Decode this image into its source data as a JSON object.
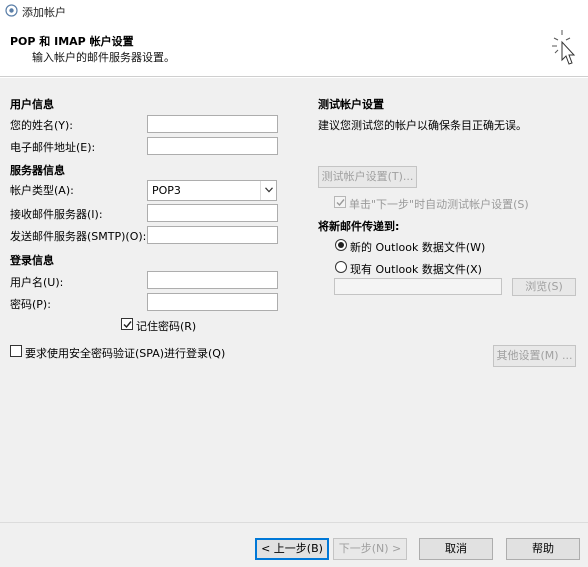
{
  "window": {
    "title": "添加帐户"
  },
  "header": {
    "title": "POP 和 IMAP 帐户设置",
    "subtitle": "输入帐户的邮件服务器设置。"
  },
  "user_info": {
    "heading": "用户信息",
    "name_label": "您的姓名(Y):",
    "name_value": "",
    "email_label": "电子邮件地址(E):",
    "email_value": ""
  },
  "server_info": {
    "heading": "服务器信息",
    "account_type_label": "帐户类型(A):",
    "account_type_value": "POP3",
    "incoming_label": "接收邮件服务器(I):",
    "incoming_value": "",
    "outgoing_label": "发送邮件服务器(SMTP)(O):",
    "outgoing_value": ""
  },
  "login_info": {
    "heading": "登录信息",
    "username_label": "用户名(U):",
    "username_value": "",
    "password_label": "密码(P):",
    "password_value": "",
    "remember_label": "记住密码(R)",
    "remember_checked": true
  },
  "spa": {
    "label": "要求使用安全密码验证(SPA)进行登录(Q)",
    "checked": false
  },
  "test_settings": {
    "heading": "测试帐户设置",
    "description": "建议您测试您的帐户以确保条目正确无误。",
    "test_button": "测试帐户设置(T)...",
    "auto_test_label": "单击\"下一步\"时自动测试帐户设置(S)",
    "auto_test_checked": true
  },
  "deliver": {
    "heading": "将新邮件传递到:",
    "new_file_label": "新的 Outlook 数据文件(W)",
    "existing_file_label": "现有 Outlook 数据文件(X)",
    "selected": "new",
    "existing_path": "",
    "browse_button": "浏览(S)"
  },
  "more_settings_button": "其他设置(M) ...",
  "footer": {
    "back_button": "< 上一步(B)",
    "next_button": "下一步(N) >",
    "cancel_button": "取消",
    "help_button": "帮助"
  }
}
